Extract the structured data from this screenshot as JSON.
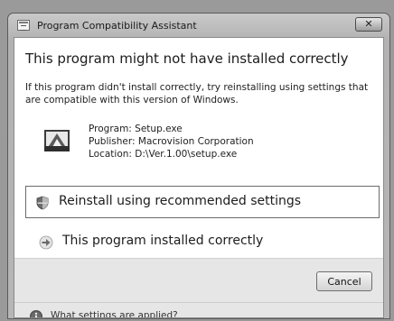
{
  "window": {
    "title": "Program Compatibility Assistant",
    "close_label": "✕"
  },
  "heading": "This program might not have installed correctly",
  "description": "If this program didn't install correctly, try reinstalling using settings that are compatible with this version of Windows.",
  "program": {
    "name_line": "Program: Setup.exe",
    "publisher_line": "Publisher: Macrovision Corporation",
    "location_line": "Location: D:\\Ver.1.00\\setup.exe"
  },
  "options": {
    "reinstall_label": "Reinstall using recommended settings",
    "installed_label": "This program installed correctly"
  },
  "footer": {
    "cancel_label": "Cancel",
    "help_link": "What settings are applied?"
  },
  "icons": {
    "title": "app-window-icon",
    "program": "setup-program-icon",
    "reinstall": "shield-icon",
    "installed": "arrow-right-icon",
    "help": "info-icon"
  }
}
